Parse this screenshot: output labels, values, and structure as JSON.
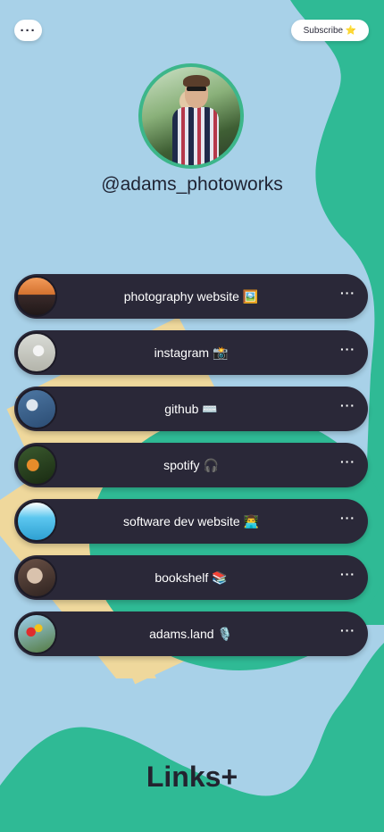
{
  "header": {
    "menu_icon": "more-horizontal-icon",
    "menu_label": "···",
    "subscribe_label": "Subscribe ⭐"
  },
  "profile": {
    "username": "@adams_photoworks",
    "avatar_icon": "profile-photo"
  },
  "links": [
    {
      "label": "photography website 🖼️",
      "thumb": "sunset-tree-photo",
      "more": "···"
    },
    {
      "label": "instagram 📸",
      "thumb": "bird-photo",
      "more": "···"
    },
    {
      "label": "github ⌨️",
      "thumb": "moon-photo",
      "more": "···"
    },
    {
      "label": "spotify 🎧",
      "thumb": "butterfly-photo",
      "more": "···"
    },
    {
      "label": "software dev website 👨‍💻",
      "thumb": "sign-photo",
      "more": "···"
    },
    {
      "label": "bookshelf 📚",
      "thumb": "drink-photo",
      "more": "···"
    },
    {
      "label": "adams.land 🎙️",
      "thumb": "balloons-photo",
      "more": "···"
    }
  ],
  "footer": {
    "brand": "Links+"
  },
  "colors": {
    "background": "#a8d1e8",
    "accent_green": "#2fba95",
    "shape_yellow": "#efd89c",
    "button_dark": "#2a2838",
    "text_dark": "#1f2333"
  }
}
